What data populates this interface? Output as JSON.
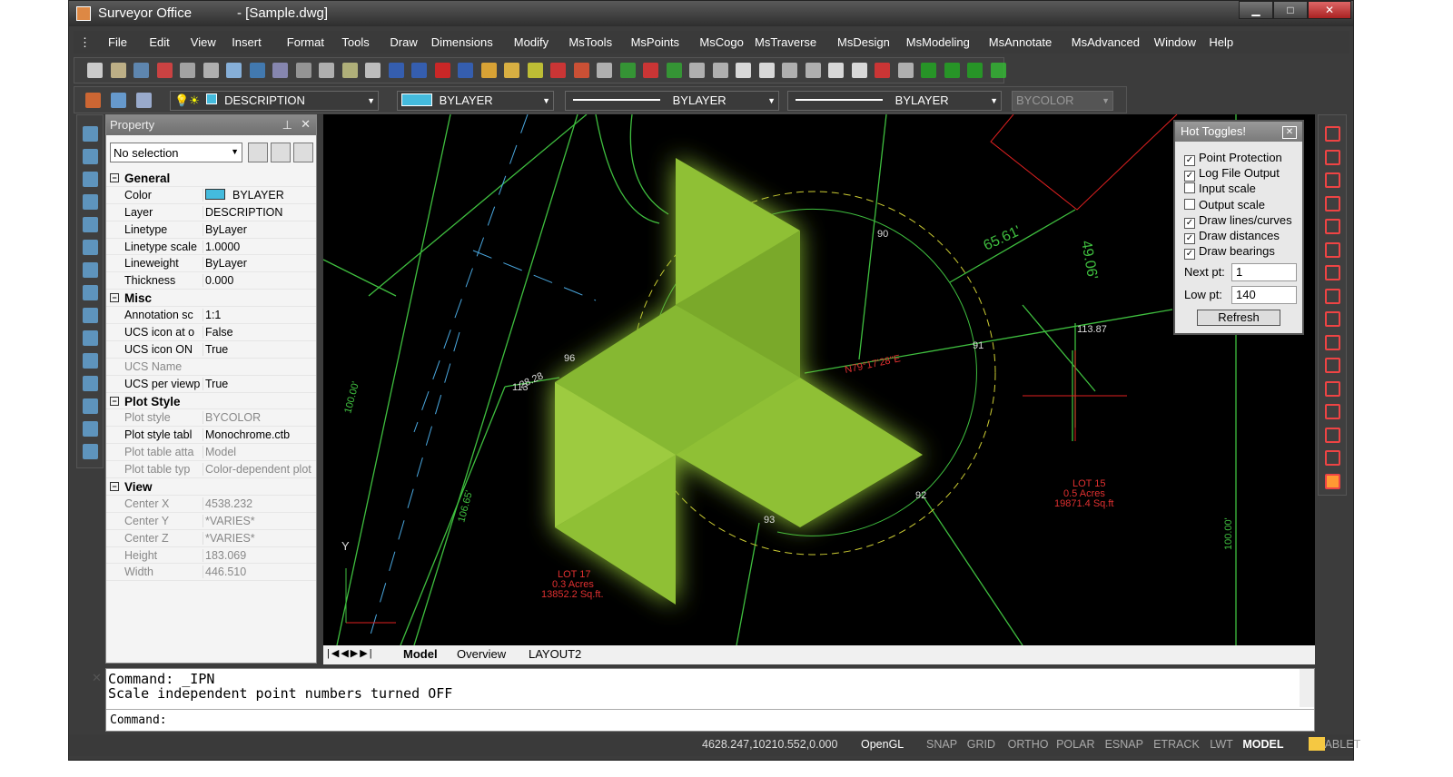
{
  "title": {
    "app": "Surveyor Office",
    "doc": "- [Sample.dwg]",
    "min": "▁",
    "max": "□",
    "close": "✕"
  },
  "menu": [
    "File",
    "Edit",
    "View",
    "Insert",
    "Format",
    "Tools",
    "Draw",
    "Dimensions",
    "Modify",
    "MsTools",
    "MsPoints",
    "MsCogo",
    "MsTraverse",
    "MsDesign",
    "MsModeling",
    "MsAnnotate",
    "MsAdvanced",
    "Window",
    "Help"
  ],
  "toolbar2": {
    "layer": "DESCRIPTION",
    "color": "BYLAYER",
    "linetype": "BYLAYER",
    "lineweight": "BYLAYER",
    "plotstyle": "BYCOLOR"
  },
  "property": {
    "title": "Property",
    "selection": "No selection",
    "sections": [
      {
        "name": "General",
        "rows": [
          [
            "Color",
            "BYLAYER",
            false
          ],
          [
            "Layer",
            "DESCRIPTION",
            false
          ],
          [
            "Linetype",
            "ByLayer",
            false
          ],
          [
            "Linetype scale",
            "1.0000",
            false
          ],
          [
            "Lineweight",
            "ByLayer",
            false
          ],
          [
            "Thickness",
            "0.000",
            false
          ]
        ]
      },
      {
        "name": "Misc",
        "rows": [
          [
            "Annotation sc",
            "1:1",
            false
          ],
          [
            "UCS icon at o",
            "False",
            false
          ],
          [
            "UCS icon ON",
            "True",
            false
          ],
          [
            "UCS Name",
            "",
            true
          ],
          [
            "UCS per viewp",
            "True",
            false
          ]
        ]
      },
      {
        "name": "Plot Style",
        "rows": [
          [
            "Plot style",
            "BYCOLOR",
            true
          ],
          [
            "Plot style tabl",
            "Monochrome.ctb",
            false
          ],
          [
            "Plot table atta",
            "Model",
            true
          ],
          [
            "Plot table typ",
            "Color-dependent plot",
            true
          ]
        ]
      },
      {
        "name": "View",
        "rows": [
          [
            "Center X",
            "4538.232",
            true
          ],
          [
            "Center Y",
            "*VARIES*",
            true
          ],
          [
            "Center Z",
            "*VARIES*",
            true
          ],
          [
            "Height",
            "183.069",
            true
          ],
          [
            "Width",
            "446.510",
            true
          ]
        ]
      }
    ]
  },
  "hot_toggles": {
    "title": "Hot Toggles!",
    "items": [
      [
        "Point Protection",
        true
      ],
      [
        "Log File Output",
        true
      ],
      [
        "Input scale",
        false
      ],
      [
        "Output scale",
        false
      ],
      [
        "Draw lines/curves",
        true
      ],
      [
        "Draw distances",
        true
      ],
      [
        "Draw bearings",
        true
      ]
    ],
    "next_pt_label": "Next pt:",
    "next_pt": "1",
    "low_pt_label": "Low pt:",
    "low_pt": "140",
    "refresh": "Refresh"
  },
  "drawing": {
    "labels": [
      "N79°17'28\"E",
      "65.61'",
      "49.06'",
      "LOT 17",
      "0.3  Acres",
      "13852.2  Sq.ft.",
      "LOT 15",
      "0.5  Acres",
      "19871.4  Sq.ft",
      "100.00'",
      "100.00'",
      "106.65'",
      "28.28",
      "90",
      "91",
      "92",
      "93",
      "96",
      "113",
      "113.87"
    ],
    "axis_y": "Y"
  },
  "tabs": [
    "Model",
    "Overview",
    "LAYOUT2"
  ],
  "command": {
    "line1": "Command: _IPN",
    "line2": "Scale independent point numbers turned OFF",
    "prompt": "Command:"
  },
  "status": {
    "coords": "4628.247,10210.552,0.000",
    "renderer": "OpenGL",
    "toggles": [
      "SNAP",
      "GRID",
      "ORTHO",
      "POLAR",
      "ESNAP",
      "ETRACK",
      "LWT",
      "MODEL",
      "TABLET"
    ]
  },
  "colors": {
    "logo": "#8fc035",
    "cad_green": "#3fbf3f",
    "cad_red": "#e02020",
    "cad_blue": "#4aa8e0"
  }
}
